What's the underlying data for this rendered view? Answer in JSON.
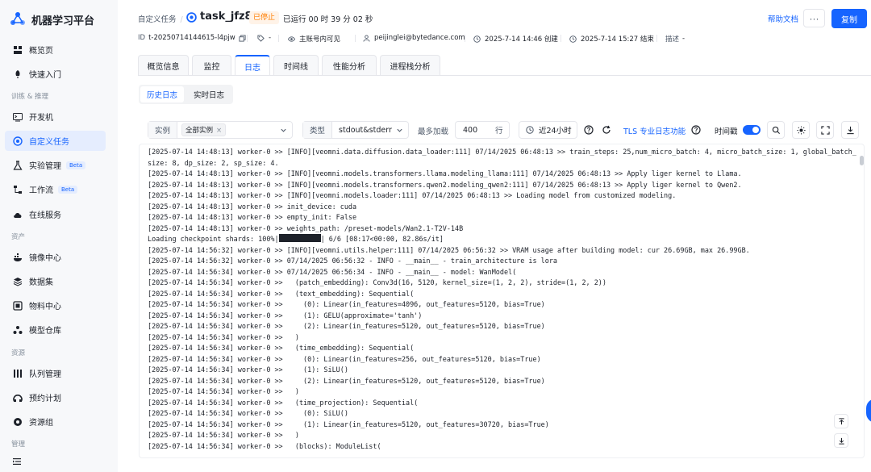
{
  "app": {
    "title": "机器学习平台"
  },
  "sidebar": {
    "items": [
      {
        "label": "概览页",
        "icon": "dashboard-icon"
      },
      {
        "label": "快速入门",
        "icon": "rocket-icon"
      },
      {
        "label": "开发机",
        "icon": "terminal-icon"
      },
      {
        "label": "自定义任务",
        "icon": "target-icon",
        "active": true
      },
      {
        "label": "实验管理",
        "icon": "flask-icon",
        "badge": "Beta"
      },
      {
        "label": "工作流",
        "icon": "workflow-icon",
        "badge": "Beta"
      },
      {
        "label": "在线服务",
        "icon": "cloud-icon"
      },
      {
        "label": "镜像中心",
        "icon": "container-icon"
      },
      {
        "label": "数据集",
        "icon": "dataset-icon"
      },
      {
        "label": "物料中心",
        "icon": "material-icon"
      },
      {
        "label": "模型仓库",
        "icon": "model-icon"
      },
      {
        "label": "队列管理",
        "icon": "queue-icon"
      },
      {
        "label": "预约计划",
        "icon": "schedule-icon"
      },
      {
        "label": "资源组",
        "icon": "resource-icon"
      }
    ],
    "groups": [
      "训练 & 推理",
      "资产",
      "资源",
      "管理"
    ]
  },
  "header": {
    "breadcrumb": "自定义任务",
    "task_name": "task_jfz8s",
    "status": "已停止",
    "runtime": "已运行 00 时 39 分 02 秒",
    "help": "帮助文档",
    "more": "···",
    "copy": "复制"
  },
  "meta": {
    "id_label": "ID",
    "id_value": "t-20250714144615-l4pjw",
    "tag_value": "-",
    "visibility": "主账号内可见",
    "owner": "peijinglei@bytedance.com",
    "created": "2025-7-14 14:46 创建",
    "ended": "2025-7-14 15:27 结束",
    "desc_label": "描述",
    "desc_value": "-"
  },
  "tabs": [
    "概览信息",
    "监控",
    "日志",
    "时间线",
    "性能分析",
    "进程栈分析"
  ],
  "active_tab": "日志",
  "subtabs": [
    "历史日志",
    "实时日志"
  ],
  "toolbar": {
    "instance_label": "实例",
    "instance_tag": "全部实例",
    "type_label": "类型",
    "type_value": "stdout&stderr",
    "max_label": "最多加载",
    "max_value": "400",
    "max_unit": "行",
    "time_range": "近24小时",
    "tls_link": "TLS 专业日志功能",
    "timestamp_label": "时间戳",
    "timestamp_on": true
  },
  "log_lines": [
    "[2025-07-14 14:48:13] worker-0 >> [INFO][veomni.data.diffusion.data_loader:111] 07/14/2025 06:48:13 >> train_steps: 25,num_micro_batch: 4, micro_batch_size: 1, global_batch_size: 8, dp_size: 2, sp_size: 4.",
    "[2025-07-14 14:48:13] worker-0 >> [INFO][veomni.models.transformers.llama.modeling_llama:111] 07/14/2025 06:48:13 >> Apply liger kernel to Llama.",
    "[2025-07-14 14:48:13] worker-0 >> [INFO][veomni.models.transformers.qwen2.modeling_qwen2:111] 07/14/2025 06:48:13 >> Apply liger kernel to Qwen2.",
    "[2025-07-14 14:48:13] worker-0 >> [INFO][veomni.models.loader:111] 07/14/2025 06:48:13 >> Loading model from customized modeling.",
    "[2025-07-14 14:48:13] worker-0 >> init_device: cuda",
    "[2025-07-14 14:48:13] worker-0 >> empty_init: False",
    "[2025-07-14 14:48:13] worker-0 >> weights_path: /preset-models/Wan2.1-T2V-14B",
    "__CHECKPOINT__",
    "[2025-07-14 14:56:32] worker-0 >> [INFO][veomni.utils.helper:111] 07/14/2025 06:56:32 >> VRAM usage after building model: cur 26.69GB, max 26.99GB.",
    "[2025-07-14 14:56:32] worker-0 >> 07/14/2025 06:56:32 - INFO - __main__ - train_architecture is lora",
    "[2025-07-14 14:56:34] worker-0 >> 07/14/2025 06:56:34 - INFO - __main__ - model: WanModel(",
    "[2025-07-14 14:56:34] worker-0 >>   (patch_embedding): Conv3d(16, 5120, kernel_size=(1, 2, 2), stride=(1, 2, 2))",
    "[2025-07-14 14:56:34] worker-0 >>   (text_embedding): Sequential(",
    "[2025-07-14 14:56:34] worker-0 >>     (0): Linear(in_features=4096, out_features=5120, bias=True)",
    "[2025-07-14 14:56:34] worker-0 >>     (1): GELU(approximate='tanh')",
    "[2025-07-14 14:56:34] worker-0 >>     (2): Linear(in_features=5120, out_features=5120, bias=True)",
    "[2025-07-14 14:56:34] worker-0 >>   )",
    "[2025-07-14 14:56:34] worker-0 >>   (time_embedding): Sequential(",
    "[2025-07-14 14:56:34] worker-0 >>     (0): Linear(in_features=256, out_features=5120, bias=True)",
    "[2025-07-14 14:56:34] worker-0 >>     (1): SiLU()",
    "[2025-07-14 14:56:34] worker-0 >>     (2): Linear(in_features=5120, out_features=5120, bias=True)",
    "[2025-07-14 14:56:34] worker-0 >>   )",
    "[2025-07-14 14:56:34] worker-0 >>   (time_projection): Sequential(",
    "[2025-07-14 14:56:34] worker-0 >>     (0): SiLU()",
    "[2025-07-14 14:56:34] worker-0 >>     (1): Linear(in_features=5120, out_features=30720, bias=True)",
    "[2025-07-14 14:56:34] worker-0 >>   )",
    "[2025-07-14 14:56:34] worker-0 >>   (blocks): ModuleList("
  ],
  "checkpoint_line": {
    "prefix": "Loading checkpoint shards: 100%|",
    "suffix": "| 6/6 [08:17<00:00, 82.86s/it]"
  },
  "colors": {
    "accent": "#1664ff",
    "stopped": "#ff7d00",
    "sidebar_bg": "#f7f8fa"
  }
}
